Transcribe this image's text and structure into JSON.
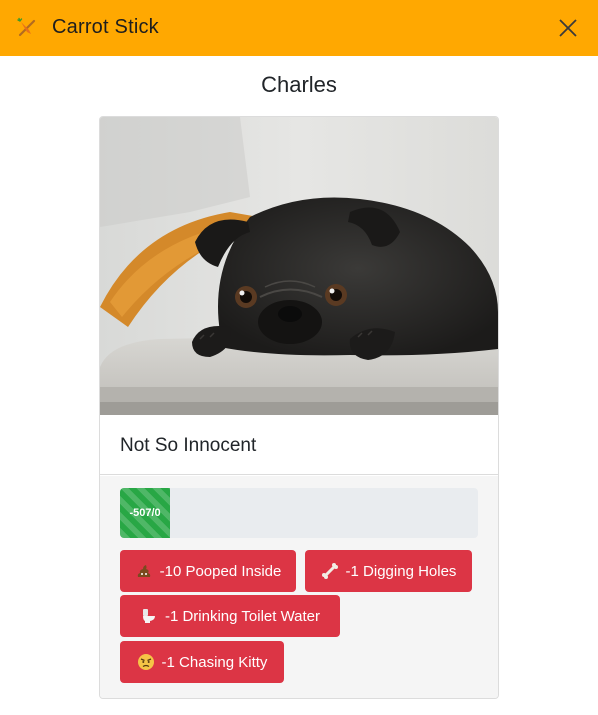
{
  "header": {
    "app_title": "Carrot Stick",
    "app_icon": "carrot-stick-icon",
    "close_icon": "close-icon",
    "brand_color": "#ffa801"
  },
  "pet": {
    "name": "Charles",
    "photo": "pug-photo",
    "status_title": "Not So Innocent"
  },
  "score": {
    "label": "-507/0",
    "fill_fraction": 0.14,
    "color": "#28a745"
  },
  "actions": [
    {
      "emoji": "poop-icon",
      "label": "-10 Pooped Inside"
    },
    {
      "emoji": "bone-icon",
      "label": "-1 Digging Holes"
    },
    {
      "emoji": "toilet-icon",
      "label": "-1 Drinking Toilet Water"
    },
    {
      "emoji": "angry-face-icon",
      "label": "-1 Chasing Kitty"
    }
  ],
  "action_color": "#dc3545"
}
